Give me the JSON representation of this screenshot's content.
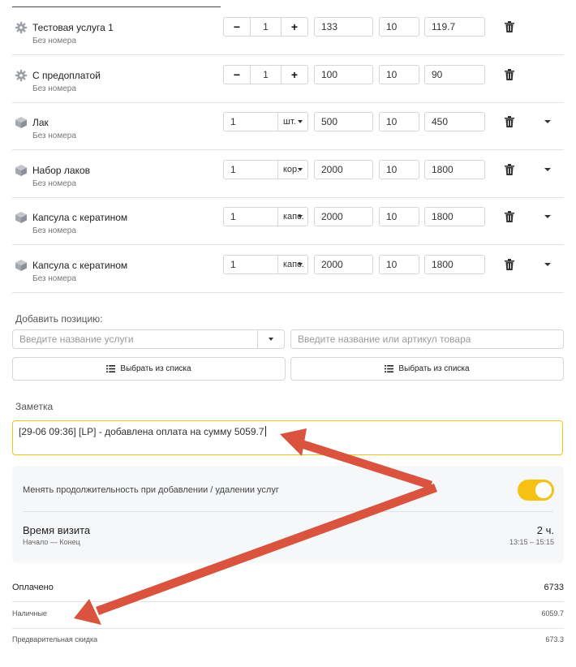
{
  "items": [
    {
      "name": "Тестовая услуга 1",
      "sub": "Без номера",
      "kind": "service",
      "qty": "1",
      "unit": "",
      "price": "133",
      "discount": "10",
      "total": "119.7"
    },
    {
      "name": "С предоплатой",
      "sub": "Без номера",
      "kind": "service",
      "qty": "1",
      "unit": "",
      "price": "100",
      "discount": "10",
      "total": "90"
    },
    {
      "name": "Лак",
      "sub": "Без номера",
      "kind": "product",
      "qty": "1",
      "unit": "шт.",
      "price": "500",
      "discount": "10",
      "total": "450"
    },
    {
      "name": "Набор лаков",
      "sub": "Без номера",
      "kind": "product",
      "qty": "1",
      "unit": "кор.",
      "price": "2000",
      "discount": "10",
      "total": "1800"
    },
    {
      "name": "Капсула с кератином",
      "sub": "Без номера",
      "kind": "product",
      "qty": "1",
      "unit": "капс.",
      "price": "2000",
      "discount": "10",
      "total": "1800"
    },
    {
      "name": "Капсула с кератином",
      "sub": "Без номера",
      "kind": "product",
      "qty": "1",
      "unit": "капс.",
      "price": "2000",
      "discount": "10",
      "total": "1800"
    }
  ],
  "stepper": {
    "minus": "−",
    "plus": "+"
  },
  "add_position": {
    "label": "Добавить позицию:",
    "service_placeholder": "Введите название услуги",
    "goods_placeholder": "Введите название или артикул товара",
    "choose_button": "Выбрать из списка"
  },
  "note": {
    "label": "Заметка",
    "value": "[29-06 09:36] [LP] - добавлена оплата на сумму 5059.7"
  },
  "visit": {
    "toggle_label": "Менять продолжительность при добавлении / удалении услуг",
    "toggle_on": true,
    "title": "Время визита",
    "subtitle": "Начало — Конец",
    "duration": "2 ч.",
    "time_range": "13:15 – 15:15"
  },
  "summary": {
    "paid_label": "Оплачено",
    "paid_value": "6733",
    "cash_label": "Наличные",
    "cash_value": "6059.7",
    "prepaid_discount_label": "Предварительная скидка",
    "prepaid_discount_value": "673.3"
  },
  "colors": {
    "accent": "#f5c214",
    "arrow": "#d9533f",
    "border": "#d5d5d5"
  }
}
